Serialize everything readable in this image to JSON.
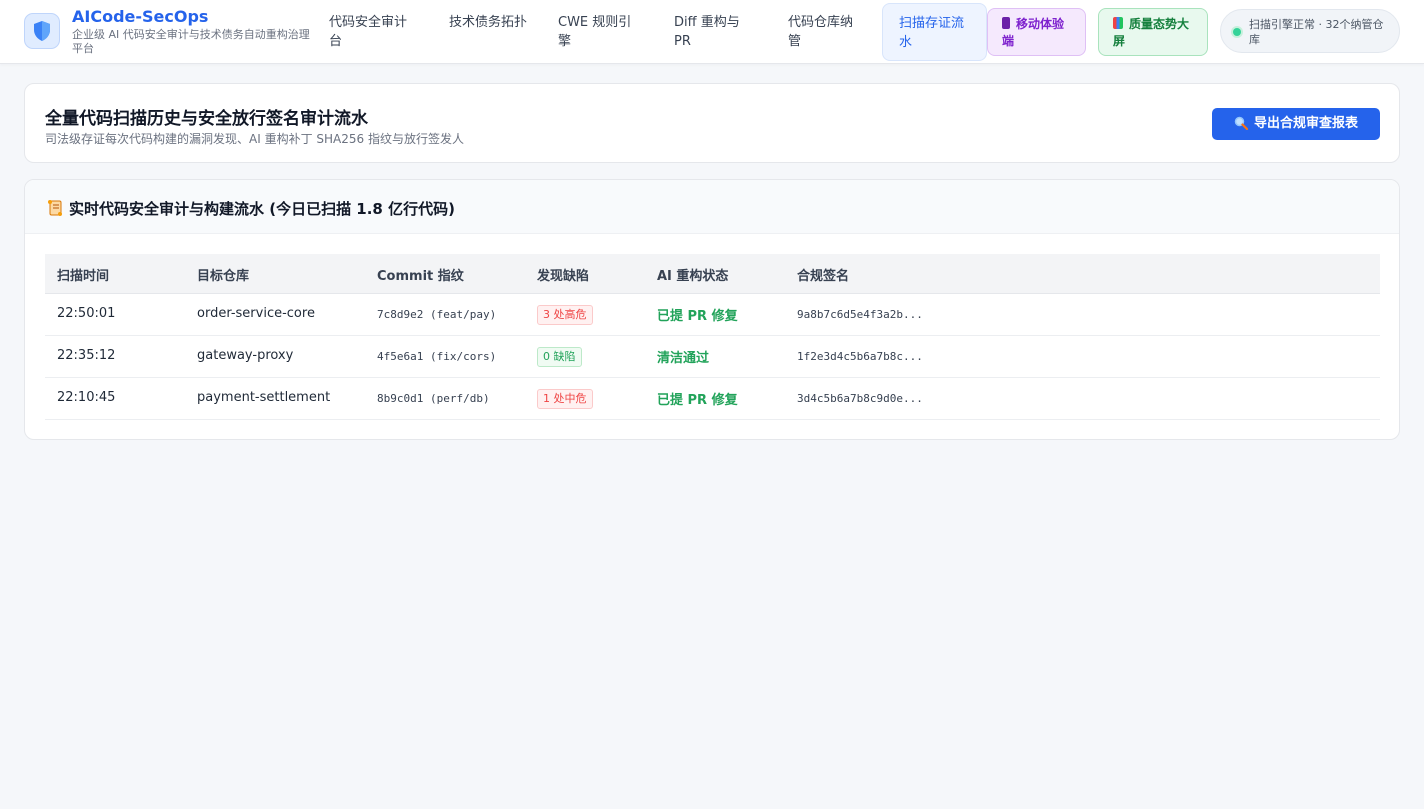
{
  "brand": {
    "title": "AICode-SecOps",
    "subtitle": "企业级 AI 代码安全审计与技术债务自动重构治理平台",
    "logo_icon": "shield-icon"
  },
  "nav": {
    "items": [
      {
        "label": "代码安全审计台"
      },
      {
        "label": "技术债务拓扑"
      },
      {
        "label": "CWE 规则引擎"
      },
      {
        "label": "Diff 重构与PR"
      },
      {
        "label": "代码仓库纳管"
      },
      {
        "label": "扫描存证流水",
        "active": true
      }
    ],
    "mobile_label": "移动体验端",
    "mobile_icon": "phone-icon",
    "screen_label": "质量态势大屏",
    "screen_icon": "bar-chart-icon",
    "status_text": "扫描引擎正常 · 32个纳管仓库"
  },
  "hero": {
    "title": "全量代码扫描历史与安全放行签名审计流水",
    "subtitle": "司法级存证每次代码构建的漏洞发现、AI 重构补丁 SHA256 指纹与放行签发人",
    "export_label": "导出合规审查报表",
    "export_icon": "search-icon"
  },
  "table": {
    "heading": "实时代码安全审计与构建流水 (今日已扫描 1.8 亿行代码)",
    "heading_icon": "scroll-icon",
    "columns": [
      "扫描时间",
      "目标仓库",
      "Commit 指纹",
      "发现缺陷",
      "AI 重构状态",
      "合规签名"
    ],
    "rows": [
      {
        "time": "22:50:01",
        "repo": "order-service-core",
        "commit": "7c8d9e2 (feat/pay)",
        "defects": "3 处高危",
        "defect_level": "red",
        "ai_status": "已提 PR 修复",
        "signature": "9a8b7c6d5e4f3a2b..."
      },
      {
        "time": "22:35:12",
        "repo": "gateway-proxy",
        "commit": "4f5e6a1 (fix/cors)",
        "defects": "0 缺陷",
        "defect_level": "green",
        "ai_status": "清洁通过",
        "signature": "1f2e3d4c5b6a7b8c..."
      },
      {
        "time": "22:10:45",
        "repo": "payment-settlement",
        "commit": "8b9c0d1 (perf/db)",
        "defects": "1 处中危",
        "defect_level": "red",
        "ai_status": "已提 PR 修复",
        "signature": "3d4c5b6a7b8c9d0e..."
      }
    ]
  },
  "colors": {
    "accent": "#2563eb",
    "success": "#22a35a",
    "danger": "#ef4444"
  }
}
